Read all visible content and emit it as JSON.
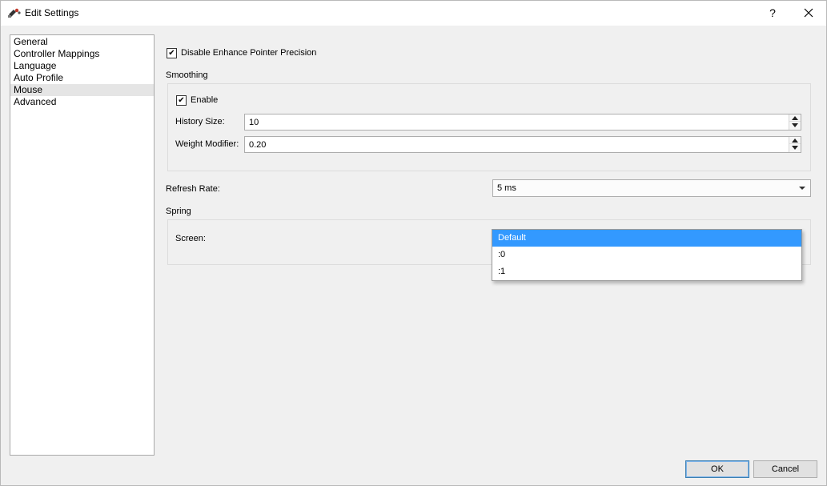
{
  "window": {
    "title": "Edit Settings",
    "help_label": "?"
  },
  "nav": {
    "items": [
      {
        "label": "General",
        "selected": false
      },
      {
        "label": "Controller Mappings",
        "selected": false
      },
      {
        "label": "Language",
        "selected": false
      },
      {
        "label": "Auto Profile",
        "selected": false
      },
      {
        "label": "Mouse",
        "selected": true
      },
      {
        "label": "Advanced",
        "selected": false
      }
    ]
  },
  "mouse": {
    "disable_precision": {
      "label": "Disable Enhance Pointer Precision",
      "checked": true
    },
    "smoothing": {
      "heading": "Smoothing",
      "enable": {
        "label": "Enable",
        "checked": true
      },
      "history_size": {
        "label": "History Size:",
        "value": "10"
      },
      "weight_modifier": {
        "label": "Weight Modifier:",
        "value": "0.20"
      }
    },
    "refresh_rate": {
      "label": "Refresh Rate:",
      "value": "5 ms"
    },
    "spring": {
      "heading": "Spring",
      "screen": {
        "label": "Screen:",
        "options": [
          "Default",
          ":0",
          ":1"
        ],
        "highlighted": "Default"
      }
    }
  },
  "footer": {
    "ok_label": "OK",
    "cancel_label": "Cancel"
  },
  "icons": {
    "app": "gamepad-icon",
    "close": "close-icon",
    "checkmark": "checkmark-icon",
    "spin_up": "arrow-up-icon",
    "spin_down": "arrow-down-icon",
    "combo": "chevron-down-icon"
  },
  "colors": {
    "selection": "#3399ff",
    "nav_selected": "#e5e5e5",
    "window_bg": "#f0f0f0"
  }
}
